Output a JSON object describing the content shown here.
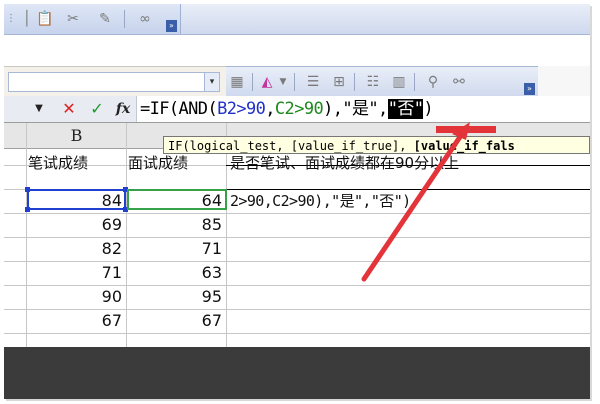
{
  "formula_bar": {
    "name_box_arrow": "▼",
    "cancel_glyph": "✕",
    "confirm_glyph": "✓",
    "fx_label": "fx",
    "formula_parts": {
      "p1": "=IF(AND(",
      "p2": "B2>90",
      "p3": ",",
      "p4": "C2>90",
      "p5": "),\"是\",",
      "p6": "\"否\"",
      "p7": ")"
    }
  },
  "tooltip": {
    "part1": "IF(logical_test, [value_if_true],",
    "part2": " [value_if_fals"
  },
  "grid": {
    "column_b_header": "B",
    "header_row": {
      "b": "笔试成绩",
      "c": "面试成绩",
      "d": "是否笔试、面试成绩都在90分以上"
    },
    "row2_d_text": "2>90,C2>90),\"是\",\"否\")",
    "rows": [
      {
        "b": "84",
        "c": "64"
      },
      {
        "b": "69",
        "c": "85"
      },
      {
        "b": "82",
        "c": "71"
      },
      {
        "b": "71",
        "c": "63"
      },
      {
        "b": "90",
        "c": "95"
      },
      {
        "b": "67",
        "c": "67"
      }
    ]
  },
  "toolbar": {
    "dropdown_arrow": "▾",
    "chevron": "»"
  },
  "colors": {
    "highlight_red": "#e3343a",
    "selection_blue": "#2040d0",
    "copy_green": "#37a14a"
  }
}
